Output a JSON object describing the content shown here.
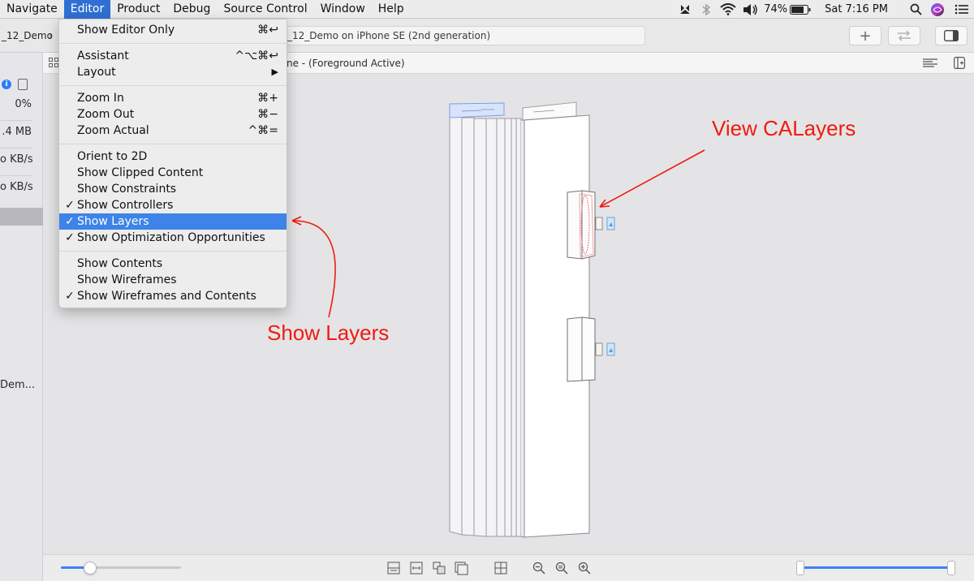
{
  "menubar": {
    "items": [
      "Navigate",
      "Editor",
      "Product",
      "Debug",
      "Source Control",
      "Window",
      "Help"
    ],
    "active_item": "Editor",
    "battery_percent": "74%",
    "clock": "Sat 7:16 PM",
    "status_icons": [
      "pinwheel-icon",
      "bluetooth-icon",
      "wifi-icon",
      "volume-icon",
      "battery-icon",
      "search-icon",
      "siri-icon",
      "list-icon"
    ]
  },
  "toolbar": {
    "scheme": "_12_Demo",
    "status": "_12_Demo on iPhone SE (2nd generation)",
    "add_label": "+"
  },
  "jumpbar": {
    "text": "ne - (Foreground Active)"
  },
  "sidebar": {
    "cpu": "0%",
    "memory": ".4 MB",
    "disk": "o KB/s",
    "network": "o KB/s",
    "process": "Dem..."
  },
  "editor_menu": {
    "items": [
      {
        "label": "Show Editor Only",
        "shortcut": "⌘↩",
        "checked": false,
        "selected": false
      },
      {
        "label": "Assistant",
        "shortcut": "^⌥⌘↩",
        "checked": false,
        "selected": false
      },
      {
        "label": "Layout",
        "shortcut": "▶",
        "checked": false,
        "selected": false
      },
      {
        "label": "Zoom In",
        "shortcut": "⌘+",
        "checked": false,
        "selected": false
      },
      {
        "label": "Zoom Out",
        "shortcut": "⌘−",
        "checked": false,
        "selected": false
      },
      {
        "label": "Zoom Actual",
        "shortcut": "^⌘=",
        "checked": false,
        "selected": false
      },
      {
        "label": "Orient to 2D",
        "shortcut": "",
        "checked": false,
        "selected": false
      },
      {
        "label": "Show Clipped Content",
        "shortcut": "",
        "checked": false,
        "selected": false
      },
      {
        "label": "Show Constraints",
        "shortcut": "",
        "checked": false,
        "selected": false
      },
      {
        "label": "Show Controllers",
        "shortcut": "",
        "checked": true,
        "selected": false
      },
      {
        "label": "Show Layers",
        "shortcut": "",
        "checked": true,
        "selected": true
      },
      {
        "label": "Show Optimization Opportunities",
        "shortcut": "",
        "checked": true,
        "selected": false
      },
      {
        "label": "Show Contents",
        "shortcut": "",
        "checked": false,
        "selected": false
      },
      {
        "label": "Show Wireframes",
        "shortcut": "",
        "checked": false,
        "selected": false
      },
      {
        "label": "Show Wireframes and Contents",
        "shortcut": "",
        "checked": true,
        "selected": false
      }
    ]
  },
  "annotations": {
    "view_calayers": "View CALayers",
    "show_layers": "Show Layers",
    "color": "#f01a0e"
  },
  "bottombar": {
    "spacing_slider_value": 0.24,
    "range_slider_low": 0.0,
    "range_slider_high": 1.0,
    "icons": [
      "frames-icon",
      "fit-icon",
      "clip-icon",
      "layers-icon",
      "orient-icon",
      "zoom-out-icon",
      "zoom-actual-icon",
      "zoom-in-icon"
    ]
  },
  "colors": {
    "accent": "#3d83e8",
    "menu_bg": "#ededed",
    "canvas_bg": "#e4e4e6"
  }
}
